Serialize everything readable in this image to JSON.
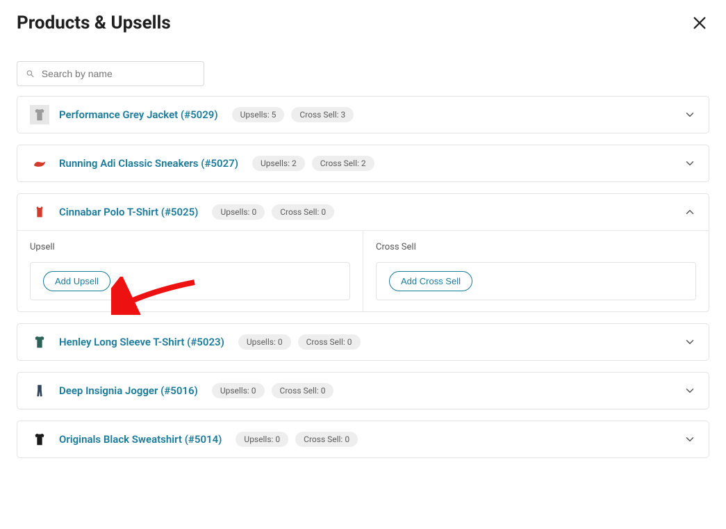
{
  "header": {
    "title": "Products & Upsells"
  },
  "search": {
    "placeholder": "Search by name"
  },
  "products": [
    {
      "name": "Performance Grey Jacket (#5029)",
      "upsells": "Upsells: 5",
      "cross": "Cross Sell: 3",
      "expanded": false,
      "thumbBg": "#e7e7e7",
      "thumbFill": "#9b9b9b"
    },
    {
      "name": "Running Adi Classic Sneakers (#5027)",
      "upsells": "Upsells: 2",
      "cross": "Cross Sell: 2",
      "expanded": false,
      "thumbBg": "#fdeceb",
      "thumbFill": "#d33b2d"
    },
    {
      "name": "Cinnabar Polo T-Shirt (#5025)",
      "upsells": "Upsells: 0",
      "cross": "Cross Sell: 0",
      "expanded": true,
      "thumbBg": "#fdeceb",
      "thumbFill": "#d33b2d"
    },
    {
      "name": "Henley Long Sleeve T-Shirt (#5023)",
      "upsells": "Upsells: 0",
      "cross": "Cross Sell: 0",
      "expanded": false,
      "thumbBg": "#dfecea",
      "thumbFill": "#2b6358"
    },
    {
      "name": "Deep Insignia Jogger (#5016)",
      "upsells": "Upsells: 0",
      "cross": "Cross Sell: 0",
      "expanded": false,
      "thumbBg": "#e8ecf2",
      "thumbFill": "#32455e"
    },
    {
      "name": "Originals Black Sweatshirt (#5014)",
      "upsells": "Upsells: 0",
      "cross": "Cross Sell: 0",
      "expanded": false,
      "thumbBg": "#e6e6e6",
      "thumbFill": "#1b1b1b"
    }
  ],
  "expanded": {
    "upsell_label": "Upsell",
    "cross_label": "Cross Sell",
    "add_upsell": "Add Upsell",
    "add_cross": "Add Cross Sell"
  }
}
